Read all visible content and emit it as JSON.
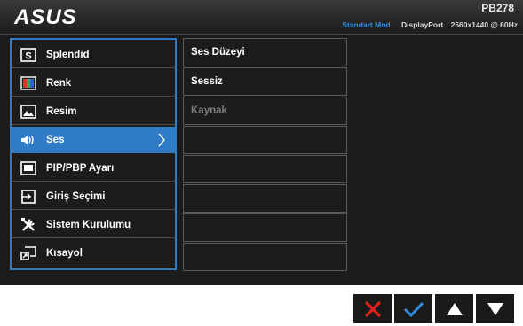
{
  "header": {
    "logo_text": "ASUS",
    "model": "PB278",
    "mode": "Standart Mod",
    "input": "DisplayPort",
    "resolution": "2560x1440 @ 60Hz"
  },
  "menu": {
    "items": [
      {
        "label": "Splendid",
        "icon": "splendid-icon"
      },
      {
        "label": "Renk",
        "icon": "color-icon"
      },
      {
        "label": "Resim",
        "icon": "image-icon"
      },
      {
        "label": "Ses",
        "icon": "speaker-icon",
        "active": true
      },
      {
        "label": "PIP/PBP Ayarı",
        "icon": "pip-icon"
      },
      {
        "label": "Giriş Seçimi",
        "icon": "input-select-icon"
      },
      {
        "label": "Sistem Kurulumu",
        "icon": "tools-icon"
      },
      {
        "label": "Kısayol",
        "icon": "shortcut-icon"
      }
    ]
  },
  "submenu": {
    "items": [
      {
        "label": "Ses Düzeyi",
        "enabled": true
      },
      {
        "label": "Sessiz",
        "enabled": true
      },
      {
        "label": "Kaynak",
        "enabled": false
      },
      {
        "label": ""
      },
      {
        "label": ""
      },
      {
        "label": ""
      },
      {
        "label": ""
      },
      {
        "label": ""
      }
    ]
  },
  "keys": [
    "close-icon",
    "check-icon",
    "up-arrow-icon",
    "down-arrow-icon"
  ],
  "colors": {
    "accent": "#2f7bc6",
    "close": "#e0201c",
    "check": "#2f8de4",
    "panel": "#1c1c1c"
  }
}
